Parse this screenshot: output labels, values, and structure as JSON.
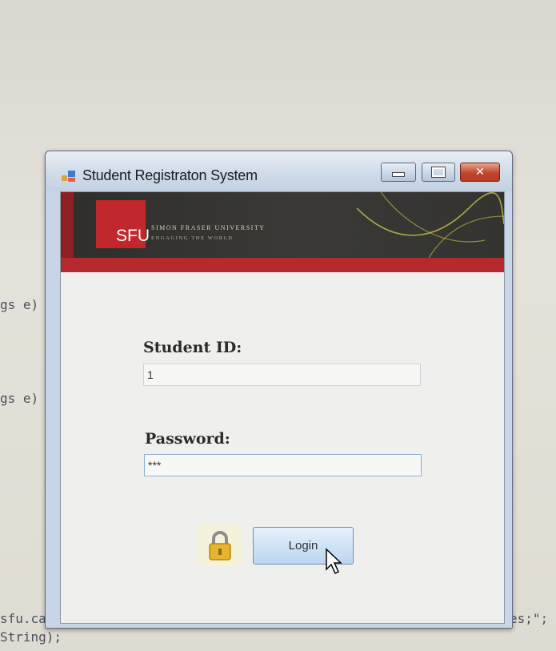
{
  "background_code": {
    "line1": "gs e)",
    "line2": "gs e)",
    "line3_left": "sfu.ca;\"",
    "line3_right": "es;\";",
    "line4": "String);"
  },
  "window": {
    "title": "Student Registraton System",
    "icon": "app-window-icon",
    "controls": [
      "minimize-icon",
      "maximize-icon",
      "close-icon"
    ]
  },
  "banner": {
    "logo_text": "SFU",
    "university_name": "SIMON FRASER UNIVERSITY",
    "tagline": "ENGAGING THE WORLD",
    "colors": {
      "red": "#c0282c",
      "dark": "#34332f"
    }
  },
  "form": {
    "student_id_label": "Student ID:",
    "student_id_value": "1",
    "password_label": "Password:",
    "password_value": "***",
    "login_label": "Login",
    "lock_icon": "lock-icon"
  }
}
